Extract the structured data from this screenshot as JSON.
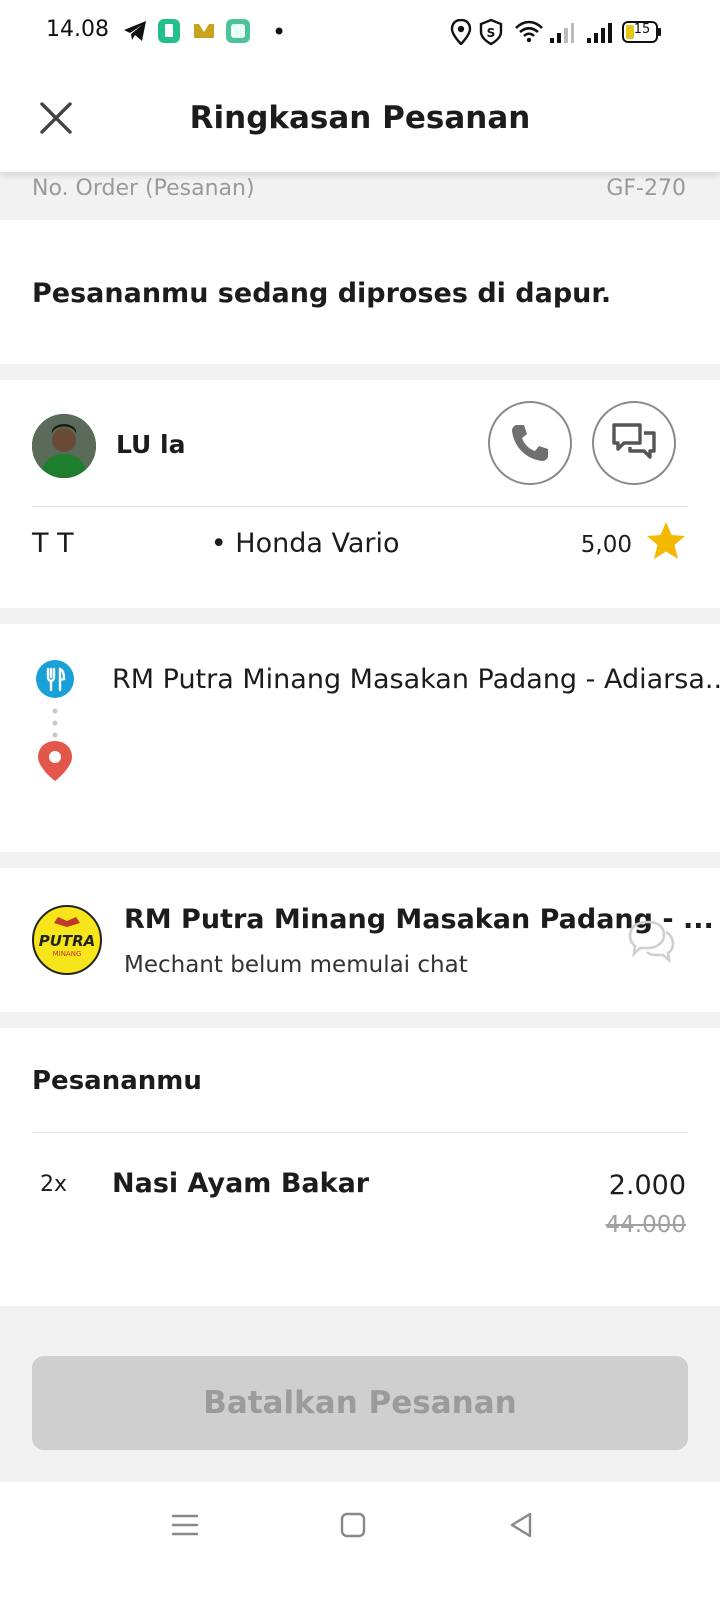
{
  "status_bar": {
    "time": "14.08",
    "battery": "15"
  },
  "header": {
    "title": "Ringkasan Pesanan"
  },
  "order": {
    "label": "No. Order (Pesanan)",
    "value": "GF-270"
  },
  "status": {
    "message": "Pesananmu sedang diproses di dapur."
  },
  "driver": {
    "name": "LU        la",
    "plate": "T T",
    "vehicle": "• Honda Vario",
    "rating": "5,00"
  },
  "route": {
    "pickup": "RM Putra Minang Masakan Padang - Adiarsa...",
    "dropoff": ""
  },
  "merchant": {
    "name": "RM Putra Minang Masakan Padang - ...",
    "subtitle": "Mechant belum memulai chat",
    "logo_text": "PUTRA",
    "logo_sub": "MINANG"
  },
  "orders": {
    "title": "Pesananmu",
    "items": [
      {
        "qty": "2x",
        "name": "Nasi Ayam Bakar",
        "price": "2.000",
        "old_price": "44.000"
      }
    ]
  },
  "actions": {
    "cancel_label": "Batalkan Pesanan"
  },
  "colors": {
    "accent_blue": "#1aa0d8",
    "pin_red": "#e3574a",
    "star": "#f5b800",
    "logo_yellow": "#f5e51a"
  }
}
